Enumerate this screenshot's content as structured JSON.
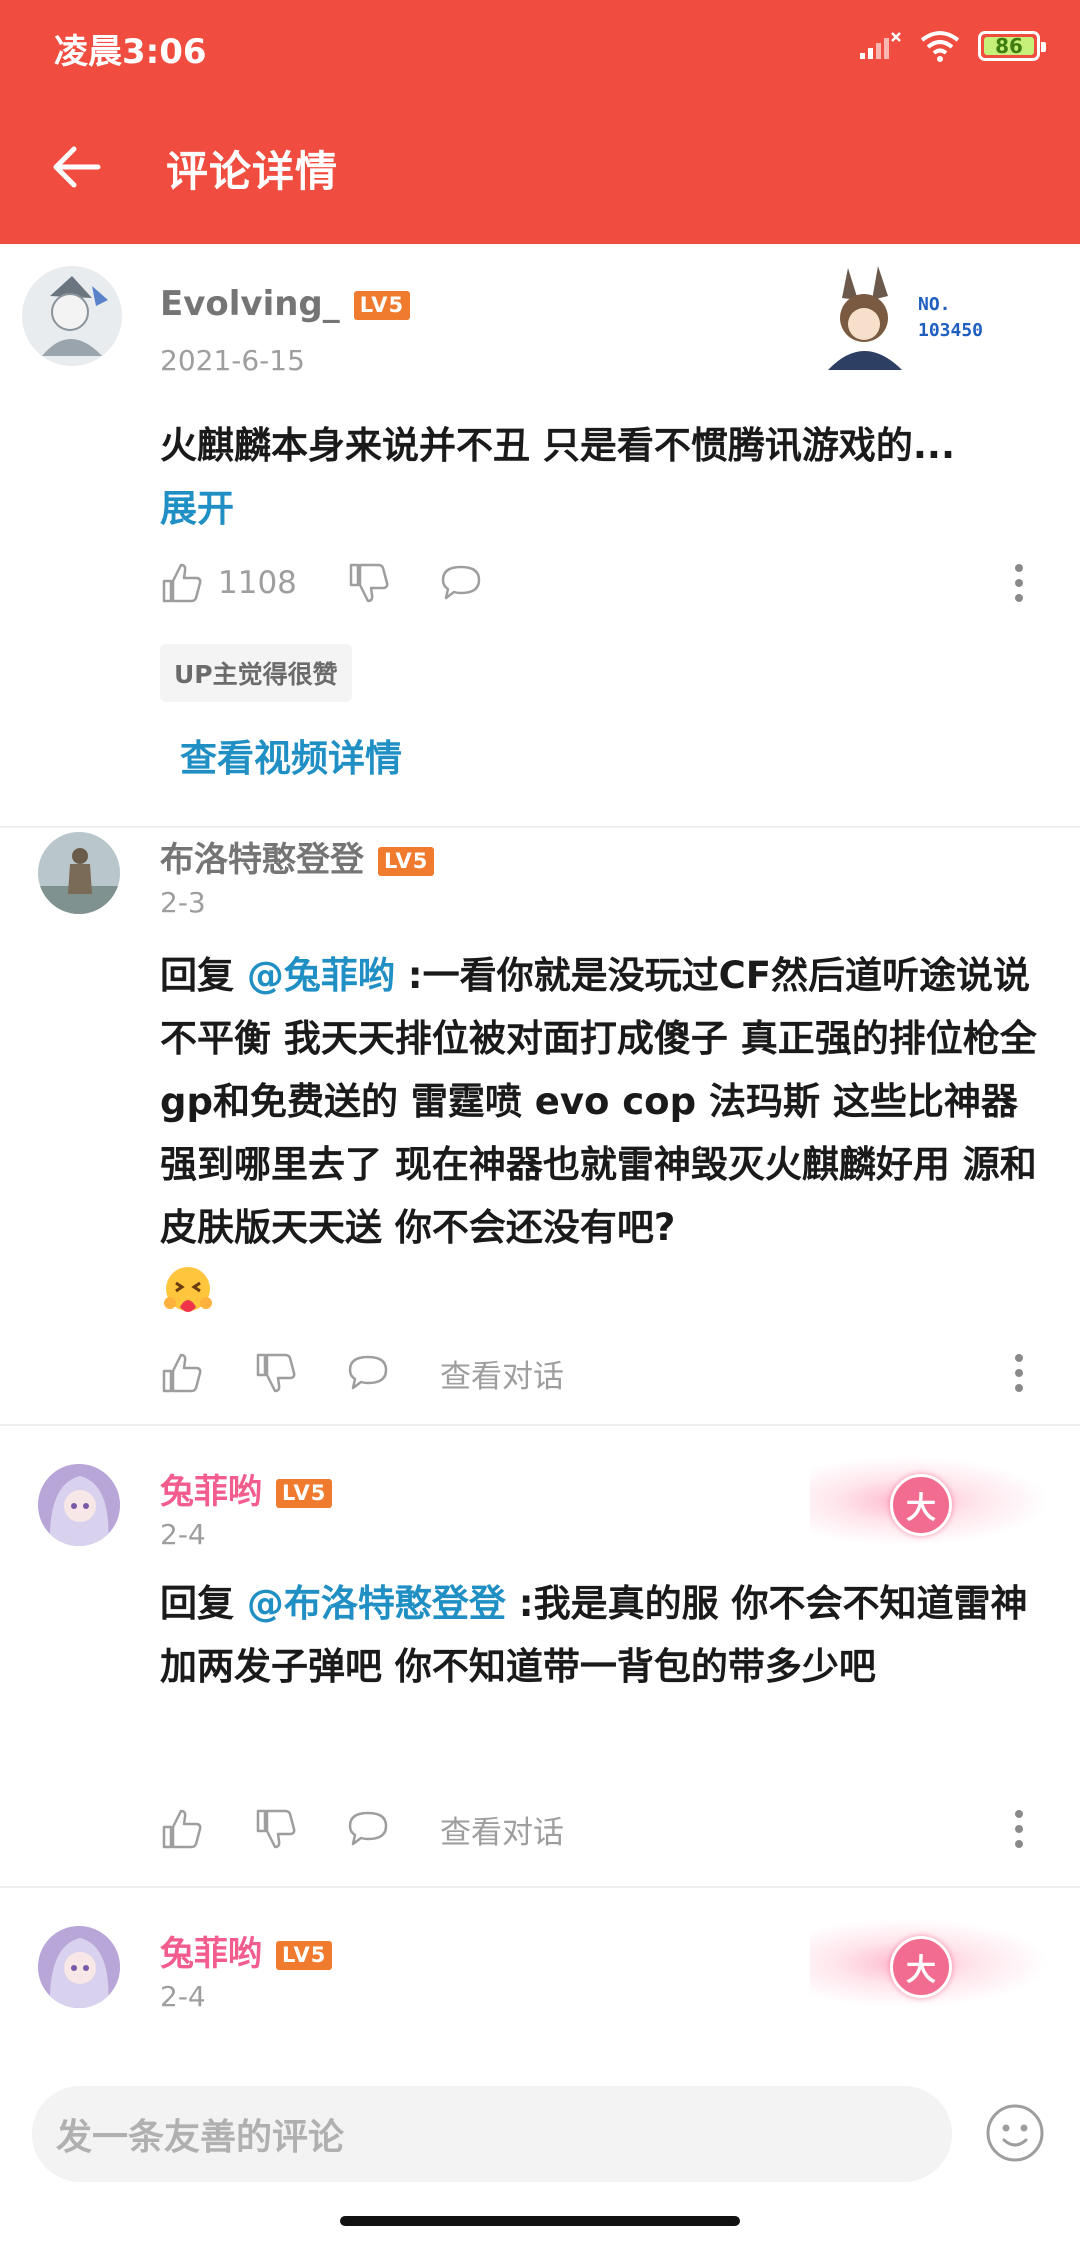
{
  "status_bar": {
    "time": "凌晨3:06",
    "battery": "86"
  },
  "header": {
    "title": "评论详情"
  },
  "comments": [
    {
      "username": "Evolving_",
      "level": "LV5",
      "date": "2021-6-15",
      "text": "火麒麟本身来说并不丑  只是看不惯腾讯游戏的...",
      "expand": "展开",
      "likes": "1108",
      "up_chip": "UP主觉得很赞",
      "video_link": "查看视频详情",
      "pendant_no_label": "NO.",
      "pendant_no_value": "103450"
    },
    {
      "username": "布洛特憨登登",
      "level": "LV5",
      "date": "2-3",
      "reply_prefix": "回复 ",
      "mention": "@兔菲哟",
      "text": " :一看你就是没玩过CF然后道听途说说不平衡 我天天排位被对面打成傻子 真正强的排位枪全gp和免费送的 雷霆喷 evo cop 法玛斯 这些比神器强到哪里去了 现在神器也就雷神毁灭火麒麟好用 源和皮肤版天天送 你不会还没有吧?",
      "view_conv": "查看对话"
    },
    {
      "username": "兔菲哟",
      "level": "LV5",
      "date": "2-4",
      "reply_prefix": "回复 ",
      "mention": "@布洛特憨登登",
      "text": " :我是真的服  你不会不知道雷神加两发子弹吧    你不知道带一背包的带多少吧",
      "view_conv": "查看对话",
      "pendant_char": "大"
    },
    {
      "username": "兔菲哟",
      "level": "LV5",
      "date": "2-4",
      "pendant_char": "大"
    }
  ],
  "input": {
    "placeholder": "发一条友善的评论"
  },
  "colors": {
    "accent": "#f04c3f",
    "link": "#1f8fc4",
    "pink_name": "#f25d8e",
    "level_badge": "#f07a2e"
  }
}
